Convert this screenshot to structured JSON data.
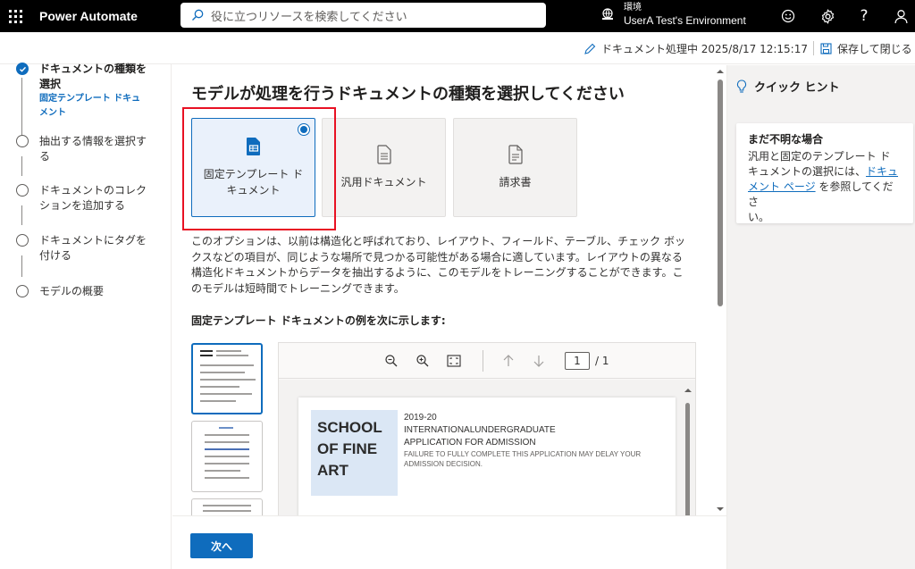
{
  "topbar": {
    "app_name": "Power Automate",
    "search_placeholder": "役に立つリソースを検索してください",
    "env_label": "環境",
    "env_name": "UserA Test's Environment"
  },
  "command_bar": {
    "status": "ドキュメント処理中 2025/8/17 12:15:17",
    "save_label": "保存して閉じる"
  },
  "steps": [
    {
      "label_line1": "ドキュメントの種類を",
      "label_line2": "選択",
      "sub_line1": "固定テンプレート ドキュ",
      "sub_line2": "メント",
      "state": "done"
    },
    {
      "label_line1": "抽出する情報を選択す",
      "label_line2": "る",
      "state": "pending"
    },
    {
      "label_line1": "ドキュメントのコレク",
      "label_line2": "ションを追加する",
      "state": "pending"
    },
    {
      "label_line1": "ドキュメントにタグを",
      "label_line2": "付ける",
      "state": "pending"
    },
    {
      "label_line1": "モデルの概要",
      "state": "pending"
    }
  ],
  "main": {
    "heading": "モデルが処理を行うドキュメントの種類を選択してください",
    "cards": [
      {
        "label_line1": "固定テンプレート ド",
        "label_line2": "キュメント",
        "icon": "fixed-template-icon",
        "selected": true
      },
      {
        "label_line1": "汎用ドキュメント",
        "icon": "document-icon",
        "selected": false
      },
      {
        "label_line1": "請求書",
        "icon": "invoice-icon",
        "selected": false
      }
    ],
    "description": [
      "このオプションは、以前は構造化と呼ばれており、レイアウト、フィールド、テーブル、チェック ボッ",
      "クスなどの項目が、同じような場所で見つかる可能性がある場合に適しています。レイアウトの異なる",
      "構造化ドキュメントからデータを抽出するように、このモデルをトレーニングすることができます。こ",
      "のモデルは短時間でトレーニングできます。"
    ],
    "examples_title": "固定テンプレート ドキュメントの例を次に示します:",
    "viewer": {
      "page_current": "1",
      "page_total": "/ 1"
    },
    "sample_doc": {
      "school_line1": "SCHOOL",
      "school_line2": "OF FINE",
      "school_line3": "ART",
      "year": "2019-20",
      "title_line1": "INTERNATIONALUNDERGRADUATE",
      "title_line2": "APPLICATION FOR ADMISSION",
      "note_line1": "FAILURE TO FULLY COMPLETE THIS APPLICATION MAY DELAY YOUR",
      "note_line2": "ADMISSION DECISION."
    },
    "next_label": "次へ"
  },
  "hints": {
    "title": "クイック ヒント",
    "card_title": "まだ不明な場合",
    "body_line1": "汎用と固定のテンプレート ド",
    "body_line2_pre": "キュメントの選択には、",
    "link_part1": "ドキュ",
    "link_part2": "メント ページ",
    "body_line3_post": " を参照してくださ",
    "body_line4": "い。"
  },
  "colors": {
    "accent": "#0f6cbd",
    "highlight": "#e81123",
    "topbar": "#000000"
  }
}
